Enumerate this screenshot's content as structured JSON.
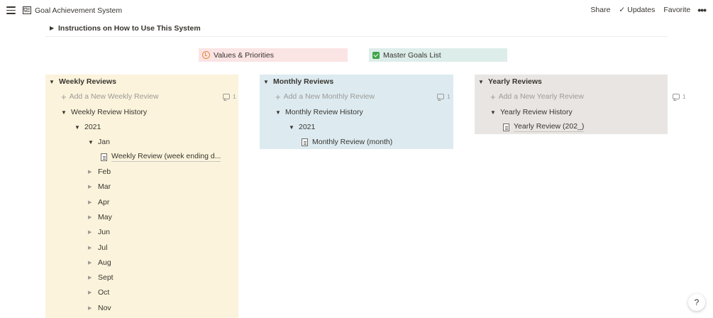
{
  "topbar": {
    "title": "Goal Achievement System",
    "share": "Share",
    "updates": "Updates",
    "favorite": "Favorite",
    "more": "•••"
  },
  "instructions": {
    "label": "Instructions on How to Use This System"
  },
  "links": {
    "values": "Values & Priorities",
    "goals": "Master Goals List"
  },
  "weekly": {
    "heading": "Weekly Reviews",
    "add": "Add a New Weekly Review",
    "comments": "1",
    "history": "Weekly Review History",
    "year": "2021",
    "jan": "Jan",
    "jan_page": "Weekly Review (week ending d...",
    "months": [
      "Feb",
      "Mar",
      "Apr",
      "May",
      "Jun",
      "Jul",
      "Aug",
      "Sept",
      "Oct",
      "Nov"
    ]
  },
  "monthly": {
    "heading": "Monthly Reviews",
    "add": "Add a New Monthly Review",
    "comments": "1",
    "history": "Monthly Review History",
    "year": "2021",
    "page": "Monthly Review (month)"
  },
  "yearly": {
    "heading": "Yearly Reviews",
    "add": "Add a New Yearly Review",
    "comments": "1",
    "history": "Yearly Review History",
    "page": "Yearly Review (202_)"
  },
  "help": "?",
  "colors": {
    "weekly_bg": "#fbf3db",
    "monthly_bg": "#ddebf1",
    "yearly_bg": "#e9e5e3",
    "values_bg": "#fbe4e4",
    "goals_bg": "#ddedea"
  }
}
